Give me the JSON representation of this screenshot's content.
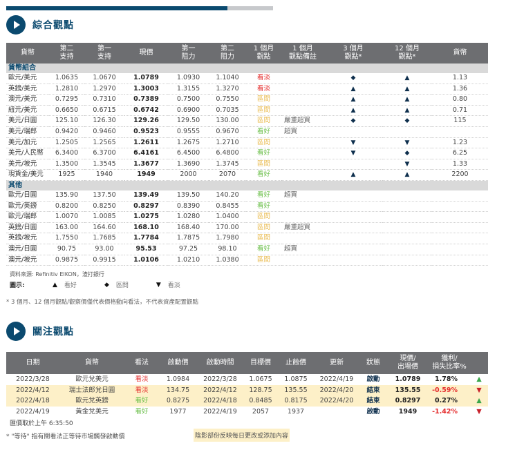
{
  "progress_fraction": 0.83,
  "section1": {
    "title": "綜合觀點"
  },
  "section2": {
    "title": "關注觀點"
  },
  "overview": {
    "headers": [
      "貨幣",
      "第二\n支持",
      "第一\n支持",
      "現價",
      "第一\n阻力",
      "第二\n阻力",
      "1 個月\n觀點",
      "1 個月\n觀點備註",
      "3 個月\n觀點*",
      "12 個月\n觀點*",
      "貨幣"
    ],
    "groups": [
      {
        "name": "貨幣組合",
        "rows": [
          {
            "pair": "歐元/美元",
            "s2": "1.0635",
            "s1": "1.0670",
            "price": "1.0789",
            "r1": "1.0930",
            "r2": "1.1040",
            "view1m": "看淡",
            "tone": "bear",
            "note": "",
            "m3": "◆",
            "m12": "▲",
            "fc": "1.13"
          },
          {
            "pair": "英鎊/美元",
            "s2": "1.2810",
            "s1": "1.2970",
            "price": "1.3003",
            "r1": "1.3155",
            "r2": "1.3270",
            "view1m": "看淡",
            "tone": "bear",
            "note": "",
            "m3": "▲",
            "m12": "▲",
            "fc": "1.36"
          },
          {
            "pair": "澳元/美元",
            "s2": "0.7295",
            "s1": "0.7310",
            "price": "0.7389",
            "r1": "0.7500",
            "r2": "0.7550",
            "view1m": "區間",
            "tone": "neut",
            "note": "",
            "m3": "▲",
            "m12": "▲",
            "fc": "0.80"
          },
          {
            "pair": "紐元/美元",
            "s2": "0.6650",
            "s1": "0.6715",
            "price": "0.6742",
            "r1": "0.6900",
            "r2": "0.7035",
            "view1m": "區間",
            "tone": "neut",
            "note": "",
            "m3": "▲",
            "m12": "▲",
            "fc": "0.71"
          },
          {
            "pair": "美元/日圓",
            "s2": "125.10",
            "s1": "126.30",
            "price": "129.26",
            "r1": "129.50",
            "r2": "130.00",
            "view1m": "區間",
            "tone": "neut",
            "note": "嚴重超買",
            "m3": "◆",
            "m12": "◆",
            "fc": "115"
          },
          {
            "pair": "美元/瑞郎",
            "s2": "0.9420",
            "s1": "0.9460",
            "price": "0.9523",
            "r1": "0.9555",
            "r2": "0.9670",
            "view1m": "看好",
            "tone": "bull",
            "note": "超買",
            "m3": "",
            "m12": "",
            "fc": ""
          },
          {
            "pair": "美元/加元",
            "s2": "1.2505",
            "s1": "1.2565",
            "price": "1.2611",
            "r1": "1.2675",
            "r2": "1.2710",
            "view1m": "區間",
            "tone": "neut",
            "note": "",
            "m3": "▼",
            "m12": "▼",
            "fc": "1.23"
          },
          {
            "pair": "美元/人民幣",
            "s2": "6.3400",
            "s1": "6.3700",
            "price": "6.4161",
            "r1": "6.4500",
            "r2": "6.4800",
            "view1m": "看好",
            "tone": "bull",
            "note": "",
            "m3": "▼",
            "m12": "◆",
            "fc": "6.25"
          },
          {
            "pair": "美元/坡元",
            "s2": "1.3500",
            "s1": "1.3545",
            "price": "1.3677",
            "r1": "1.3690",
            "r2": "1.3745",
            "view1m": "區間",
            "tone": "neut",
            "note": "",
            "m3": "",
            "m12": "▼",
            "fc": "1.33"
          },
          {
            "pair": "現貨金/美元",
            "s2": "1925",
            "s1": "1940",
            "price": "1949",
            "r1": "2000",
            "r2": "2070",
            "view1m": "看好",
            "tone": "bull",
            "note": "",
            "m3": "▲",
            "m12": "▲",
            "fc": "2200"
          }
        ]
      },
      {
        "name": "其他",
        "rows": [
          {
            "pair": "歐元/日圓",
            "s2": "135.90",
            "s1": "137.50",
            "price": "139.49",
            "r1": "139.50",
            "r2": "140.20",
            "view1m": "看好",
            "tone": "bull",
            "note": "超買",
            "m3": "",
            "m12": "",
            "fc": ""
          },
          {
            "pair": "歐元/英鎊",
            "s2": "0.8200",
            "s1": "0.8250",
            "price": "0.8297",
            "r1": "0.8390",
            "r2": "0.8455",
            "view1m": "看好",
            "tone": "bull",
            "note": "",
            "m3": "",
            "m12": "",
            "fc": ""
          },
          {
            "pair": "歐元/瑞郎",
            "s2": "1.0070",
            "s1": "1.0085",
            "price": "1.0275",
            "r1": "1.0280",
            "r2": "1.0400",
            "view1m": "區間",
            "tone": "neut",
            "note": "",
            "m3": "",
            "m12": "",
            "fc": ""
          },
          {
            "pair": "英鎊/日圓",
            "s2": "163.00",
            "s1": "164.60",
            "price": "168.10",
            "r1": "168.40",
            "r2": "170.00",
            "view1m": "區間",
            "tone": "neut",
            "note": "嚴重超買",
            "m3": "",
            "m12": "",
            "fc": ""
          },
          {
            "pair": "英鎊/坡元",
            "s2": "1.7550",
            "s1": "1.7685",
            "price": "1.7784",
            "r1": "1.7875",
            "r2": "1.7980",
            "view1m": "區間",
            "tone": "neut",
            "note": "",
            "m3": "",
            "m12": "",
            "fc": ""
          },
          {
            "pair": "澳元/日圓",
            "s2": "90.75",
            "s1": "93.00",
            "price": "95.53",
            "r1": "97.25",
            "r2": "98.10",
            "view1m": "看好",
            "tone": "bull",
            "note": "超買",
            "m3": "",
            "m12": "",
            "fc": ""
          },
          {
            "pair": "澳元/坡元",
            "s2": "0.9875",
            "s1": "0.9915",
            "price": "1.0106",
            "r1": "1.0210",
            "r2": "1.0380",
            "view1m": "區間",
            "tone": "neut",
            "note": "",
            "m3": "",
            "m12": "",
            "fc": ""
          }
        ]
      }
    ]
  },
  "source": "資料來源: Refinitiv EIKON，渣打銀行",
  "legend": {
    "label": "圖示:",
    "items": [
      {
        "glyph": "▲",
        "text": "看好"
      },
      {
        "glyph": "◆",
        "text": "區間"
      },
      {
        "glyph": "▼",
        "text": "看淡"
      }
    ]
  },
  "footnote1": "* 3 個月、12 個月觀點/觀察價僅代表價格動向看法，不代表資產配置觀點",
  "focus": {
    "headers": [
      "日期",
      "貨幣",
      "看法",
      "啟動價",
      "啟動時間",
      "目標價",
      "止蝕價",
      "更新",
      "狀態",
      "現價/\n出場價",
      "獲利/\n損失比率%"
    ],
    "rows": [
      {
        "date": "2022/3/28",
        "ccy": "歐元兌美元",
        "view": "看淡",
        "tone": "bear",
        "entry": "1.0984",
        "entry_time": "2022/3/28",
        "target": "1.0675",
        "stop": "1.0875",
        "update": "2022/4/19",
        "status": "啟動",
        "now": "1.0789",
        "pnl": "1.78%",
        "pnl_tone": "pos",
        "arrow": "▲",
        "arrow_tone": "up",
        "highlight": false
      },
      {
        "date": "2022/4/12",
        "ccy": "瑞士法郎兌日圓",
        "view": "看淡",
        "tone": "bear",
        "entry": "134.75",
        "entry_time": "2022/4/12",
        "target": "128.75",
        "stop": "135.55",
        "update": "2022/4/20",
        "status": "結束",
        "now": "135.55",
        "pnl": "-0.59%",
        "pnl_tone": "neg",
        "arrow": "▼",
        "arrow_tone": "dn",
        "highlight": true
      },
      {
        "date": "2022/4/18",
        "ccy": "歐元兌英鎊",
        "view": "看好",
        "tone": "bull",
        "entry": "0.8275",
        "entry_time": "2022/4/18",
        "target": "0.8485",
        "stop": "0.8175",
        "update": "2022/4/20",
        "status": "結束",
        "now": "0.8297",
        "pnl": "0.27%",
        "pnl_tone": "pos",
        "arrow": "▲",
        "arrow_tone": "up",
        "highlight": true
      },
      {
        "date": "2022/4/19",
        "ccy": "黃金兌美元",
        "view": "看好",
        "tone": "bull",
        "entry": "1977",
        "entry_time": "2022/4/19",
        "target": "2057",
        "stop": "1937",
        "update": "",
        "status": "啟動",
        "now": "1949",
        "pnl": "-1.42%",
        "pnl_tone": "neg",
        "arrow": "▼",
        "arrow_tone": "dn",
        "highlight": false
      }
    ]
  },
  "timestamp": "匯價取於上午 6:35:50",
  "footnote2": "* \"等待\" 指有關看法正等待市場觸發啟動價",
  "shade_note": "陰影部份反映每日更改或添加內容",
  "colors": {
    "brand": "#0b4a6f",
    "bull": "#6bbf4a",
    "bear": "#e52d2d",
    "neutral": "#e9b94a",
    "highlight": "#fdf0c8"
  }
}
